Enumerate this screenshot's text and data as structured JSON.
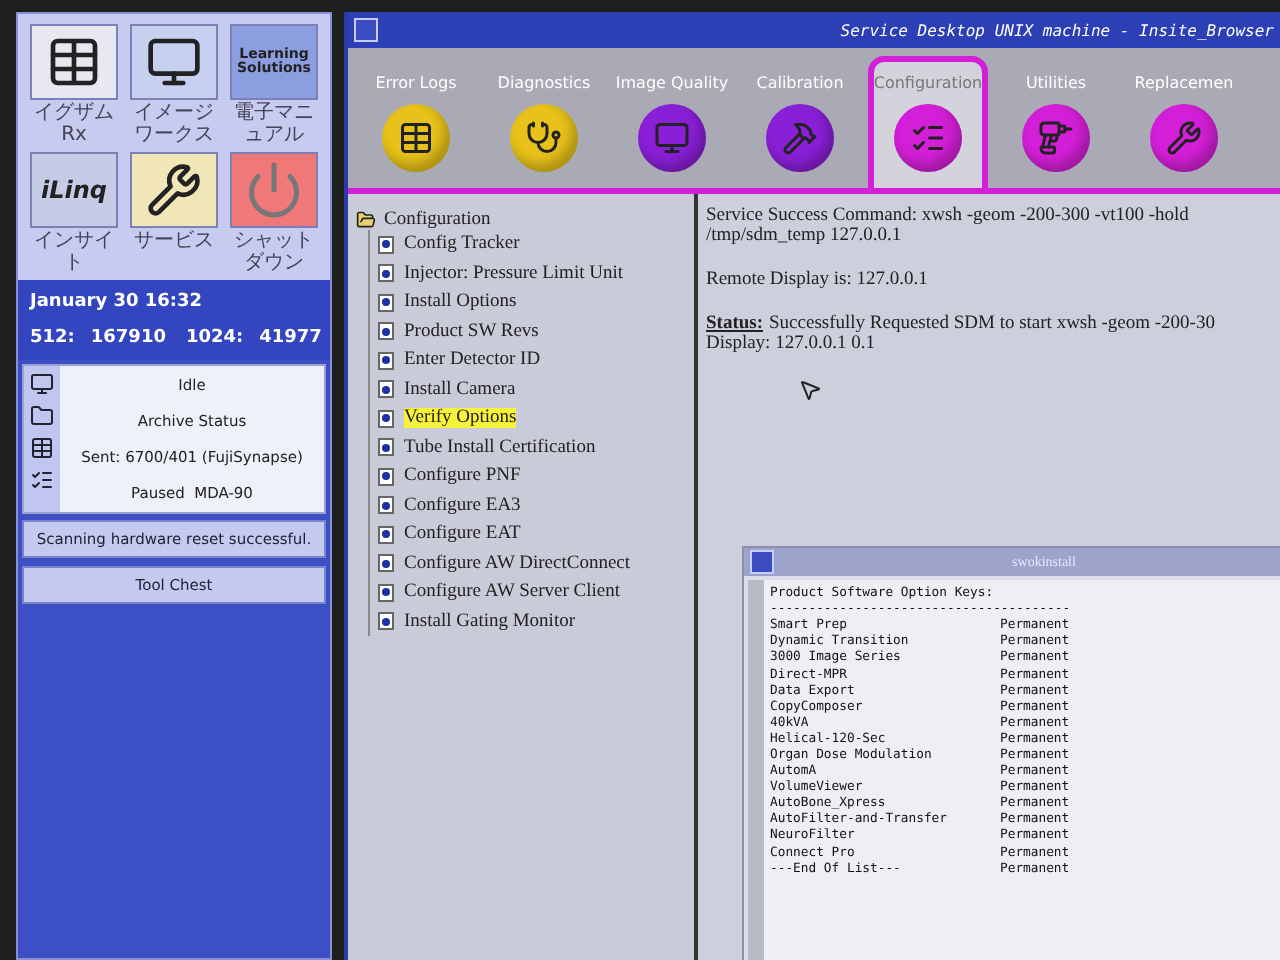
{
  "launcher": {
    "tiles": [
      {
        "kind": "exam",
        "label": "イグザムRx"
      },
      {
        "kind": "workstation",
        "label": "イメージワークス"
      },
      {
        "kind": "text",
        "tile_text": "Learning Solutions",
        "label": "電子マニュアル"
      },
      {
        "kind": "linq",
        "tile_text": "iLinq",
        "label": "インサイト"
      },
      {
        "kind": "tools",
        "label": "サービス"
      },
      {
        "kind": "power",
        "label": "シャットダウン"
      }
    ]
  },
  "info": {
    "date": "January 30 16:32",
    "counters": [
      {
        "label": "512:",
        "value": "167910"
      },
      {
        "label": "1024:",
        "value": "41977"
      }
    ]
  },
  "status_card": {
    "lines": [
      "Idle",
      "Archive Status",
      "Sent: 6700/401 (FujiSynapse)",
      "Paused  MDA-90"
    ]
  },
  "message": "Scanning hardware reset successful.",
  "tool_chest": "Tool Chest",
  "window": {
    "title": "Service Desktop UNIX machine - Insite_Browser"
  },
  "tabs": [
    {
      "label": "Error Logs",
      "color": "#e8c21a",
      "selected": false
    },
    {
      "label": "Diagnostics",
      "color": "#e8c21a",
      "selected": false
    },
    {
      "label": "Image Quality",
      "color": "#8a1fd8",
      "selected": false
    },
    {
      "label": "Calibration",
      "color": "#8a1fd8",
      "selected": false
    },
    {
      "label": "Configuration",
      "color": "#d41fd8",
      "selected": true
    },
    {
      "label": "Utilities",
      "color": "#d41fd8",
      "selected": false
    },
    {
      "label": "Replacemen",
      "color": "#d41fd8",
      "selected": false
    }
  ],
  "tree": {
    "label": "Configuration",
    "expanded": true,
    "children": [
      {
        "label": "Config Tracker",
        "selected": false
      },
      {
        "label": "Injector: Pressure Limit Unit",
        "selected": false
      },
      {
        "label": "Install Options",
        "selected": false
      },
      {
        "label": "Product SW Revs",
        "selected": false
      },
      {
        "label": "Enter Detector ID",
        "selected": false
      },
      {
        "label": "Install Camera",
        "selected": false
      },
      {
        "label": "Verify Options",
        "selected": true
      },
      {
        "label": "Tube Install Certification",
        "selected": false
      },
      {
        "label": "Configure PNF",
        "selected": false
      },
      {
        "label": "Configure EA3",
        "selected": false
      },
      {
        "label": "Configure EAT",
        "selected": false
      },
      {
        "label": "Configure AW DirectConnect",
        "selected": false
      },
      {
        "label": "Configure AW Server Client",
        "selected": false
      },
      {
        "label": "Install Gating Monitor",
        "selected": false
      }
    ]
  },
  "output": {
    "command_lines": [
      "Service Success Command: xwsh -geom -200-300 -vt100 -hold",
      "/tmp/sdm_temp 127.0.0.1"
    ],
    "remote": "Remote Display is: 127.0.0.1",
    "status_label": "Status:",
    "status_text": "Successfully Requested SDM to start xwsh -geom -200-30",
    "display": "Display: 127.0.0.1 0.1"
  },
  "terminal": {
    "title": "swokinstall",
    "heading": "Product Software Option Keys:",
    "rule": "---------------------------------------",
    "rows": [
      {
        "name": "Smart Prep",
        "value": "Permanent"
      },
      {
        "name": "Dynamic Transition",
        "value": "Permanent"
      },
      {
        "name": "3000 Image Series",
        "value": "Permanent"
      },
      {
        "name": "Direct-MPR",
        "value": "Permanent"
      },
      {
        "name": "Data Export",
        "value": "Permanent"
      },
      {
        "name": "CopyComposer",
        "value": "Permanent"
      },
      {
        "name": "40kVA",
        "value": "Permanent"
      },
      {
        "name": "Helical-120-Sec",
        "value": "Permanent"
      },
      {
        "name": "Organ Dose Modulation",
        "value": "Permanent"
      },
      {
        "name": "AutomA",
        "value": "Permanent"
      },
      {
        "name": "VolumeViewer",
        "value": "Permanent"
      },
      {
        "name": "AutoBone_Xpress",
        "value": "Permanent"
      },
      {
        "name": "AutoFilter-and-Transfer",
        "value": "Permanent"
      },
      {
        "name": "NeuroFilter",
        "value": "Permanent"
      },
      {
        "name": "Connect Pro",
        "value": "Permanent"
      },
      {
        "name": "---End Of List---",
        "value": "Permanent"
      }
    ]
  }
}
